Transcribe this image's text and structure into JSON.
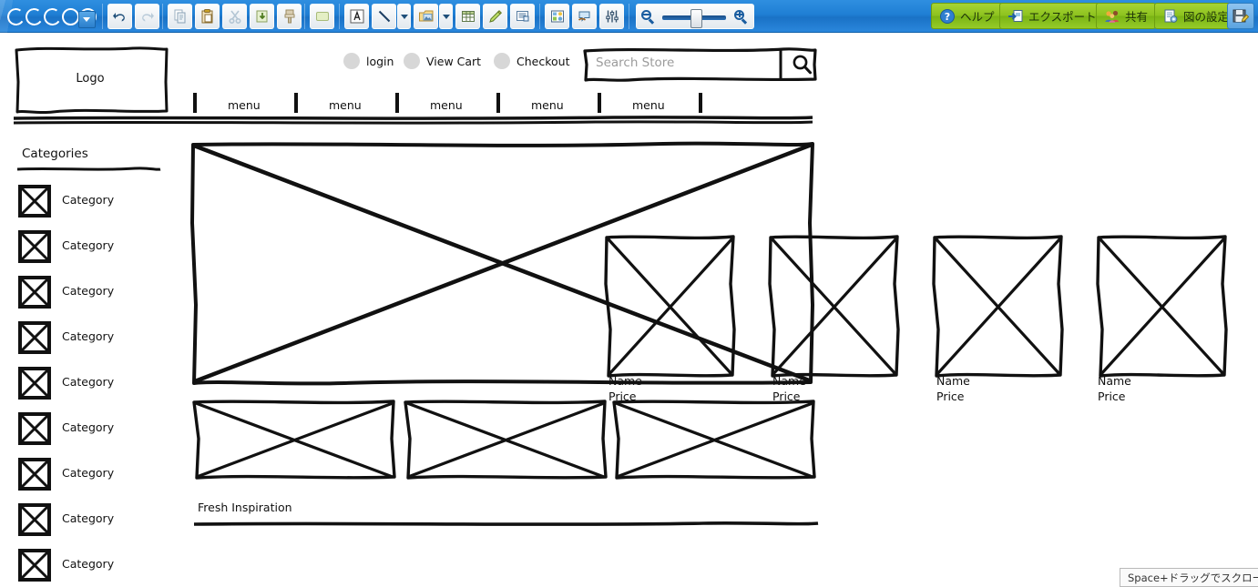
{
  "app": {
    "name": "Cacoo",
    "logo_text": "Cacoo"
  },
  "toolbar": {
    "tools": [
      {
        "name": "undo-button",
        "label": "元に戻す"
      },
      {
        "name": "redo-button",
        "label": "やり直し"
      },
      {
        "name": "copy-button",
        "label": "コピー"
      },
      {
        "name": "paste-button",
        "label": "貼り付け"
      },
      {
        "name": "cut-button",
        "label": "切り取り"
      },
      {
        "name": "duplicate-button",
        "label": "複製"
      },
      {
        "name": "format-painter-button",
        "label": "書式のコピー"
      },
      {
        "name": "shape-button",
        "label": "図形"
      },
      {
        "name": "text-button",
        "label": "テキスト"
      },
      {
        "name": "line-button",
        "label": "線"
      },
      {
        "name": "image-button",
        "label": "画像"
      },
      {
        "name": "table-button",
        "label": "表"
      },
      {
        "name": "pen-button",
        "label": "ペン"
      },
      {
        "name": "note-button",
        "label": "付箋"
      },
      {
        "name": "stencil-button",
        "label": "ステンシル"
      },
      {
        "name": "comment-button",
        "label": "コメント"
      },
      {
        "name": "properties-button",
        "label": "プロパティ"
      }
    ],
    "zoom": {
      "zoom_out_label": "縮小",
      "zoom_in_label": "拡大",
      "value": 50
    },
    "actions": [
      {
        "name": "help-button",
        "label": "ヘルプ",
        "icon": "question-circle-icon"
      },
      {
        "name": "export-button",
        "label": "エクスポート",
        "icon": "export-icon"
      },
      {
        "name": "share-button",
        "label": "共有",
        "icon": "people-icon"
      },
      {
        "name": "diagram-settings-button",
        "label": "図の設定",
        "icon": "document-gear-icon"
      }
    ],
    "save_label": "保存"
  },
  "wireframe": {
    "logo": {
      "label": "Logo"
    },
    "account_links": [
      {
        "label": "login"
      },
      {
        "label": "View Cart"
      },
      {
        "label": "Checkout"
      }
    ],
    "search": {
      "placeholder": "Search Store",
      "button_icon": "search-icon"
    },
    "nav": {
      "items": [
        {
          "label": "menu"
        },
        {
          "label": "menu"
        },
        {
          "label": "menu"
        },
        {
          "label": "menu"
        },
        {
          "label": "menu"
        }
      ]
    },
    "sidebar": {
      "title": "Categories",
      "items": [
        {
          "label": "Category"
        },
        {
          "label": "Category"
        },
        {
          "label": "Category"
        },
        {
          "label": "Category"
        },
        {
          "label": "Category"
        },
        {
          "label": "Category"
        },
        {
          "label": "Category"
        },
        {
          "label": "Category"
        },
        {
          "label": "Category"
        }
      ]
    },
    "hero": {
      "alt": "hero-image-placeholder"
    },
    "products": [
      {
        "name": "Name",
        "price": "Price"
      },
      {
        "name": "Name",
        "price": "Price"
      },
      {
        "name": "Name",
        "price": "Price"
      },
      {
        "name": "Name",
        "price": "Price"
      }
    ],
    "promo_banners": [
      {
        "alt": "promo-placeholder"
      },
      {
        "alt": "promo-placeholder"
      },
      {
        "alt": "promo-placeholder"
      }
    ],
    "section": {
      "title": "Fresh Inspiration"
    }
  },
  "status": {
    "hint": "Space+ドラッグでスクロール"
  },
  "colors": {
    "toolbar_blue": "#1f7fd4",
    "action_green": "#8cc21e",
    "sketch_ink": "#111111",
    "placeholder_gray": "#9b9b9b",
    "dot_gray": "#d7d7d7"
  }
}
